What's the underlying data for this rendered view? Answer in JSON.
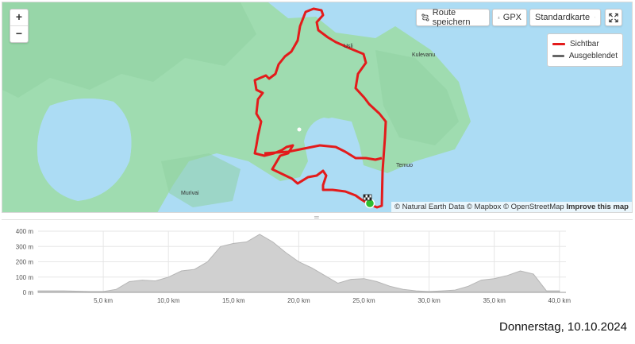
{
  "map": {
    "zoom_in": "+",
    "zoom_out": "−",
    "place_labels": [
      "Usli",
      "Kulevanu",
      "Temuo",
      "Murivai"
    ],
    "attribution": "© Natural Earth Data © Mapbox © OpenStreetMap",
    "attribution_link": "Improve this map",
    "colors": {
      "water": "#acdcf4",
      "land": "#9fdcb0",
      "route": "#e31b1b",
      "start": "#2ebd2e"
    }
  },
  "toolbar": {
    "save_route": "Route speichern",
    "gpx": "GPX",
    "map_style": "Standardkarte"
  },
  "legend": {
    "visible": "Sichtbar",
    "hidden": "Ausgeblendet"
  },
  "chart_data": {
    "type": "area",
    "x": [
      0,
      2,
      4,
      5,
      6,
      7,
      8,
      9,
      10,
      11,
      12,
      13,
      14,
      15,
      16,
      17,
      18,
      19,
      20,
      21,
      22,
      23,
      24,
      25,
      26,
      27,
      28,
      29,
      30,
      31,
      32,
      33,
      34,
      35,
      36,
      37,
      38,
      39,
      40
    ],
    "values": [
      10,
      10,
      5,
      5,
      20,
      70,
      80,
      75,
      100,
      140,
      150,
      200,
      300,
      320,
      330,
      380,
      330,
      260,
      200,
      160,
      110,
      60,
      85,
      90,
      70,
      40,
      20,
      10,
      5,
      10,
      15,
      40,
      80,
      90,
      110,
      140,
      120,
      10,
      10
    ],
    "xlabel": "",
    "ylabel": "",
    "xlim": [
      0,
      40.5
    ],
    "ylim": [
      0,
      400
    ],
    "yticks": [
      "0 m",
      "100 m",
      "200 m",
      "300 m",
      "400 m"
    ],
    "xticks": [
      "5,0 km",
      "10,0 km",
      "15,0 km",
      "20,0 km",
      "25,0 km",
      "30,0 km",
      "35,0 km",
      "40,0 km"
    ],
    "fill": "#d0d0d0",
    "stroke": "#b5b5b5"
  },
  "date_text": "Donnerstag, 10.10.2024"
}
